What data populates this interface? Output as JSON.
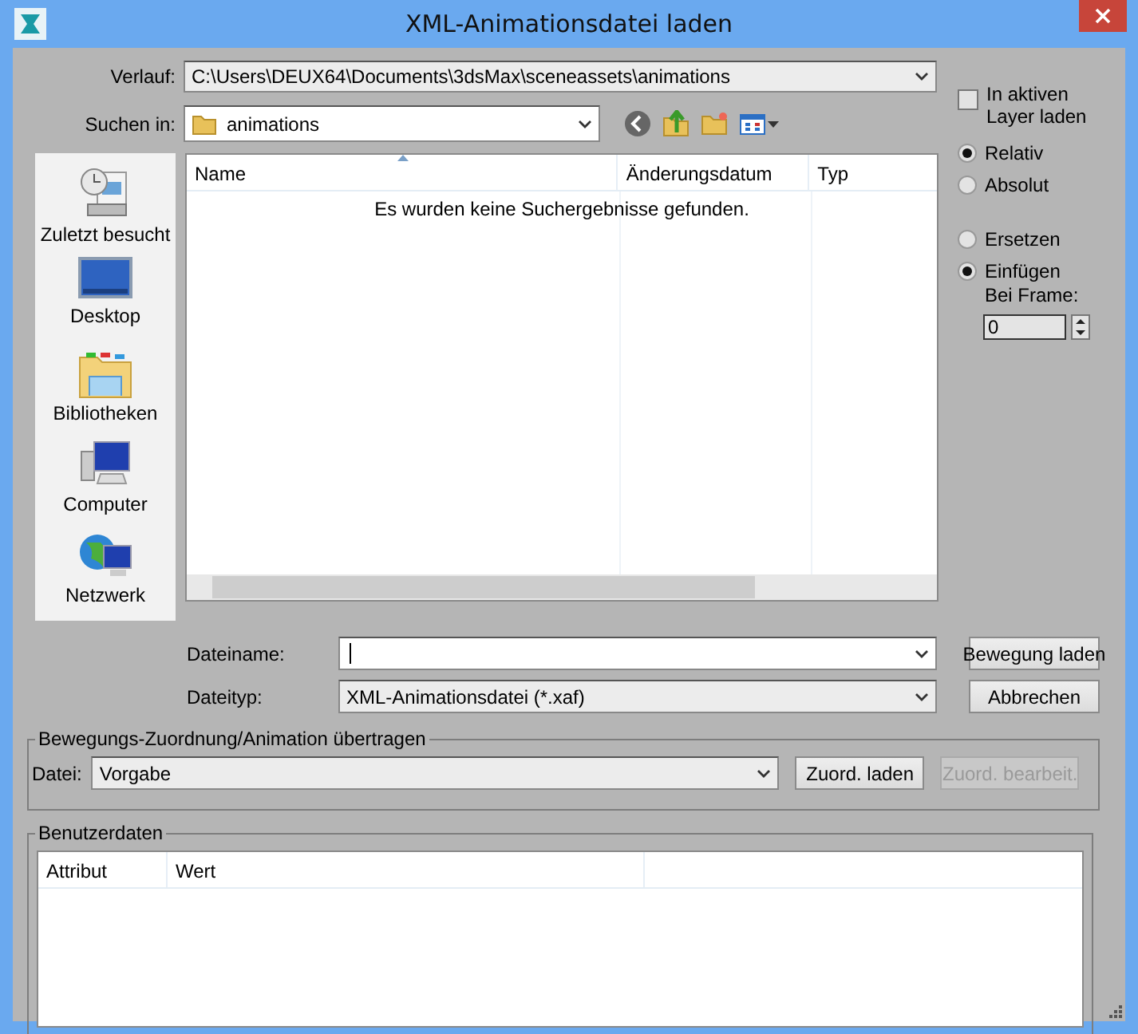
{
  "window": {
    "title": "XML-Animationsdatei laden"
  },
  "history": {
    "label": "Verlauf:",
    "value": "C:\\Users\\DEUX64\\Documents\\3dsMax\\sceneassets\\animations"
  },
  "look_in": {
    "label": "Suchen in:",
    "value": "animations"
  },
  "places": [
    {
      "label": "Zuletzt besucht",
      "kind": "recent"
    },
    {
      "label": "Desktop",
      "kind": "desktop"
    },
    {
      "label": "Bibliotheken",
      "kind": "libraries"
    },
    {
      "label": "Computer",
      "kind": "computer"
    },
    {
      "label": "Netzwerk",
      "kind": "network"
    }
  ],
  "file_list": {
    "columns": [
      "Name",
      "Änderungsdatum",
      "Typ"
    ],
    "empty_message": "Es wurden keine Suchergebnisse gefunden."
  },
  "file_name": {
    "label": "Dateiname:"
  },
  "file_type": {
    "label": "Dateityp:",
    "value": "XML-Animationsdatei (*.xaf)"
  },
  "buttons": [
    {
      "label": "Bewegung laden"
    },
    {
      "label": "Abbrechen"
    }
  ],
  "options": {
    "layer_checkbox": {
      "label": "In aktiven Layer laden",
      "checked": false
    },
    "position_radios": [
      {
        "label": "Relativ",
        "selected": true
      },
      {
        "label": "Absolut",
        "selected": false
      }
    ],
    "mode_radios": [
      {
        "label": "Ersetzen",
        "selected": false
      },
      {
        "label": "Einfügen",
        "selected": true
      }
    ],
    "frame": {
      "label": "Bei Frame:",
      "value": "0"
    }
  },
  "retarget": {
    "title": "Bewegungs-Zuordnung/Animation übertragen",
    "file_label": "Datei:",
    "file_value": "Vorgabe",
    "buttons": [
      {
        "label": "Zuord. laden",
        "disabled": false
      },
      {
        "label": "Zuord. bearbeit.",
        "disabled": true
      }
    ]
  },
  "user_data": {
    "title": "Benutzerdaten",
    "columns": [
      "Attribut",
      "Wert"
    ]
  }
}
